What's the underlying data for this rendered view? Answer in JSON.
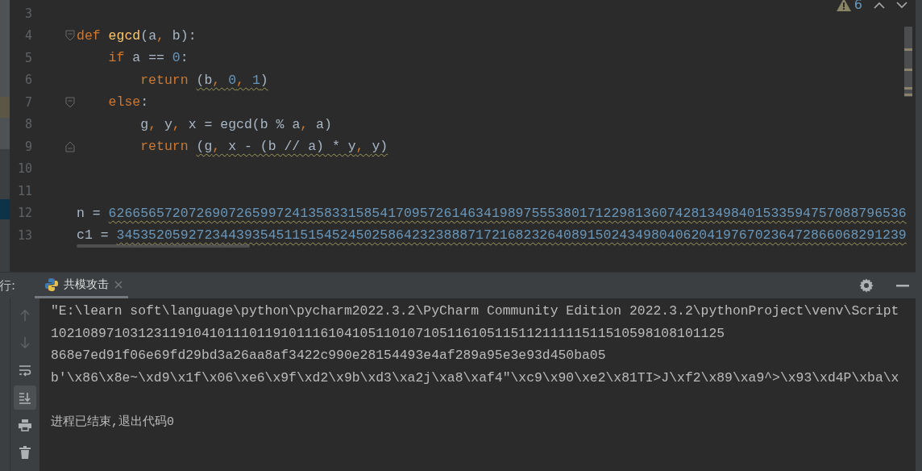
{
  "editor": {
    "inspection": {
      "count": "6"
    },
    "lines": [
      {
        "number": "3",
        "fold_open": false,
        "fold_close": false
      },
      {
        "number": "4",
        "fold_open": true,
        "fold_close": false,
        "tokens": [
          {
            "kind": "keyword",
            "text": "def",
            "wavy": false
          },
          {
            "kind": "function",
            "text": " egcd",
            "wavy": false
          },
          {
            "kind": "plain",
            "text": "(a",
            "wavy": false
          },
          {
            "kind": "comma",
            "text": ", ",
            "wavy": false
          },
          {
            "kind": "plain",
            "text": "b):",
            "wavy": false
          }
        ]
      },
      {
        "number": "5",
        "fold_open": false,
        "fold_close": false,
        "tokens": [
          {
            "kind": "keyword",
            "text": "    if",
            "wavy": false
          },
          {
            "kind": "plain",
            "text": " a == ",
            "wavy": false
          },
          {
            "kind": "number",
            "text": "0",
            "wavy": false
          },
          {
            "kind": "plain",
            "text": ":",
            "wavy": false
          }
        ]
      },
      {
        "number": "6",
        "fold_open": false,
        "fold_close": false,
        "tokens": [
          {
            "kind": "keyword",
            "text": "        return ",
            "wavy": false
          },
          {
            "kind": "plain",
            "text": "(b",
            "wavy": true
          },
          {
            "kind": "comma",
            "text": ", ",
            "wavy": true
          },
          {
            "kind": "number",
            "text": "0",
            "wavy": true
          },
          {
            "kind": "comma",
            "text": ", ",
            "wavy": true
          },
          {
            "kind": "number",
            "text": "1",
            "wavy": true
          },
          {
            "kind": "plain",
            "text": ")",
            "wavy": true
          }
        ]
      },
      {
        "number": "7",
        "fold_open": true,
        "fold_close": false,
        "tokens": [
          {
            "kind": "keyword",
            "text": "    else",
            "wavy": false
          },
          {
            "kind": "plain",
            "text": ":",
            "wavy": false
          }
        ]
      },
      {
        "number": "8",
        "fold_open": false,
        "fold_close": false,
        "tokens": [
          {
            "kind": "plain",
            "text": "        g",
            "wavy": false
          },
          {
            "kind": "comma",
            "text": ", ",
            "wavy": false
          },
          {
            "kind": "plain",
            "text": "y",
            "wavy": false
          },
          {
            "kind": "comma",
            "text": ", ",
            "wavy": false
          },
          {
            "kind": "plain",
            "text": "x = egcd(b % a",
            "wavy": false
          },
          {
            "kind": "comma",
            "text": ", ",
            "wavy": false
          },
          {
            "kind": "plain",
            "text": "a)",
            "wavy": false
          }
        ]
      },
      {
        "number": "9",
        "fold_open": false,
        "fold_close": true,
        "tokens": [
          {
            "kind": "keyword",
            "text": "        return ",
            "wavy": false
          },
          {
            "kind": "plain",
            "text": "(g",
            "wavy": true
          },
          {
            "kind": "comma",
            "text": ", ",
            "wavy": true
          },
          {
            "kind": "plain",
            "text": "x - (b // a) * y",
            "wavy": true
          },
          {
            "kind": "comma",
            "text": ", ",
            "wavy": true
          },
          {
            "kind": "plain",
            "text": "y)",
            "wavy": true
          }
        ]
      },
      {
        "number": "10",
        "fold_open": false,
        "fold_close": false
      },
      {
        "number": "11",
        "fold_open": false,
        "fold_close": false
      },
      {
        "number": "12",
        "fold_open": false,
        "fold_close": false,
        "tokens": [
          {
            "kind": "plain",
            "text": "n = ",
            "wavy": false
          },
          {
            "kind": "number",
            "text": "6266565720726907265997241358331585417095726146341989755538017122981360742813498401533594757088796536",
            "wavy": true
          }
        ]
      },
      {
        "number": "13",
        "fold_open": false,
        "fold_close": false,
        "tokens": [
          {
            "kind": "plain",
            "text": "c1 = ",
            "wavy": false
          },
          {
            "kind": "number",
            "text": "345352059272344393545115154524502586423238887172168232640891502434980406204197670236472866068291239",
            "wavy": true
          }
        ]
      }
    ]
  },
  "run_panel": {
    "label": "行:",
    "tabs": [
      {
        "label": "共模攻击",
        "selected": true
      }
    ],
    "tools": [
      {
        "kind": "up",
        "selected": false,
        "disabled": true
      },
      {
        "kind": "down",
        "selected": false,
        "disabled": true
      },
      {
        "kind": "wrap",
        "selected": false,
        "disabled": false
      },
      {
        "kind": "scroll_end",
        "selected": true,
        "disabled": false
      },
      {
        "kind": "print",
        "selected": false,
        "disabled": false
      },
      {
        "kind": "trash",
        "selected": false,
        "disabled": false
      }
    ],
    "output": [
      "\"E:\\learn soft\\language\\python\\pycharm2022.3.2\\PyCharm Community Edition 2022.3.2\\pythonProject\\venv\\Script",
      "1021089710312311910410111011910111610410511010710511610511511211111511510598108101125",
      "868e7ed91f06e69fd29bd3a26aa8af3422c990e28154493e4af289a95e3e93d450ba05",
      "b'\\x86\\x8e~\\xd9\\x1f\\x06\\xe6\\x9f\\xd2\\x9b\\xd3\\xa2j\\xa8\\xaf4\"\\xc9\\x90\\xe2\\x81TI>J\\xf2\\x89\\xa9^>\\x93\\xd4P\\xba\\x"
    ],
    "exit_message": "进程已结束,退出代码0"
  }
}
